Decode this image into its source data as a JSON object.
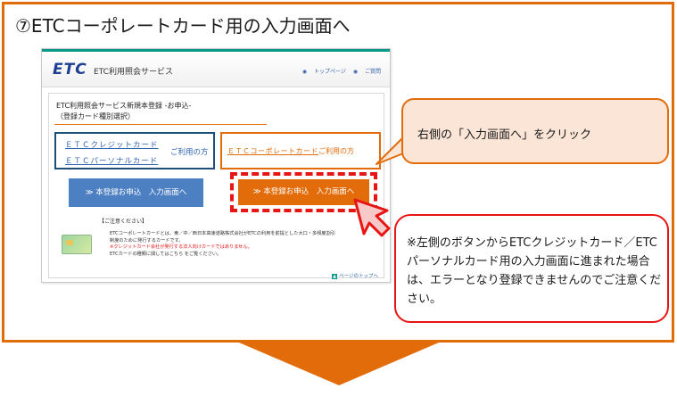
{
  "heading": "⑦ETCコーポレートカード用の入力画面へ",
  "panel": {
    "logo": "ETC",
    "site_name": "ETC利用照会サービス",
    "top_links": [
      "トップページ",
      "ご質問"
    ],
    "content_title_line1": "ETC利用照会サービス新規本登録 -お申込-",
    "content_title_line2": "（登録カード種別選択）",
    "left_card": {
      "line1": "ＥＴＣクレジットカード",
      "line2": "ＥＴＣパーソナルカード",
      "suffix": "ご利用の方"
    },
    "right_card": {
      "name": "ＥＴＣコーポレートカード",
      "suffix": "ご利用の方"
    },
    "btn_left": "≫ 本登録お申込　入力画面へ",
    "btn_right": "≫ 本登録お申込　入力画面へ",
    "note_head": "【ご注意ください】",
    "note_line1": "ETCコーポレートカードとは、東／中／西日本高速道路株式会社がETCの利用を前提とした大口・多頻度割引",
    "note_line2": "制度のために発行するカードです。",
    "note_line3": "※クレジットカード会社が発行する法人向けカードではありません。",
    "note_line4": "ETCカードの種類に関してはこちら をご覧ください。",
    "page_top": "ページのトップへ"
  },
  "callout1": "右側の「入力画面へ」をクリック",
  "callout2": "※左側のボタンからETCクレジットカード／ETCパーソナルカード用の入力画面に進まれた場合は、エラーとなり登録できませんのでご注意ください。",
  "colors": {
    "accent_orange": "#e36c0a",
    "alert_red": "#e81515",
    "link_blue": "#2d64b3",
    "button_blue": "#4d7fc3",
    "callout_fill": "#fbe5d6"
  },
  "icons": [
    "pointer-arrow-icon",
    "page-top-icon",
    "etc-card-icon"
  ]
}
